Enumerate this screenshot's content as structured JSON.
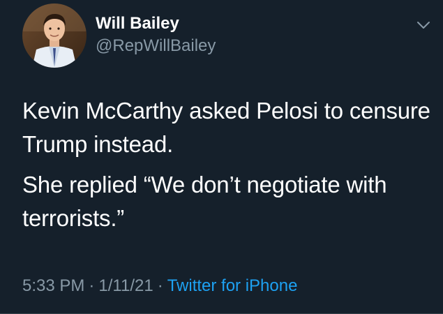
{
  "author": {
    "display_name": "Will Bailey",
    "handle": "@RepWillBailey",
    "avatar_icon": "profile-photo"
  },
  "tweet": {
    "paragraphs": [
      "Kevin McCarthy asked Pelosi to censure Trump instead.",
      "She replied “We don’t negotiate with terrorists.”"
    ],
    "time": "5:33 PM",
    "date": "1/11/21",
    "separator": "·",
    "source": "Twitter for iPhone"
  },
  "menu": {
    "icon": "chevron-down-icon"
  },
  "colors": {
    "background": "#15202b",
    "text": "#ffffff",
    "secondary_text": "#8899a6",
    "link": "#1da1f2"
  }
}
